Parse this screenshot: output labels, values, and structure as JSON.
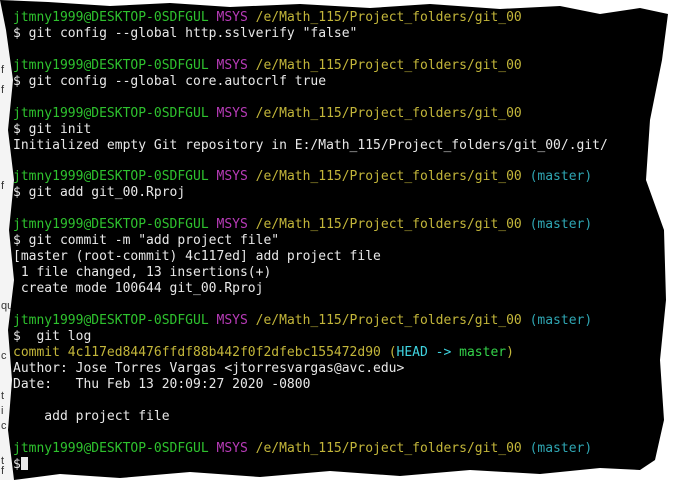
{
  "prompt": {
    "user_host": "jtmny1999@DESKTOP-0SDFGUL",
    "system": "MSYS",
    "path": "/e/Math_115/Project_folders/git_00",
    "branch": "(master)"
  },
  "blocks": [
    {
      "branch": false,
      "lines": [
        "$ git config --global http.sslverify \"false\""
      ]
    },
    {
      "branch": false,
      "lines": [
        "$ git config --global core.autocrlf true"
      ]
    },
    {
      "branch": false,
      "lines": [
        "$ git init",
        "Initialized empty Git repository in E:/Math_115/Project_folders/git_00/.git/"
      ]
    },
    {
      "branch": true,
      "lines": [
        "$ git add git_00.Rproj"
      ]
    },
    {
      "branch": true,
      "lines": [
        "$ git commit -m \"add project file\"",
        "[master (root-commit) 4c117ed] add project file",
        " 1 file changed, 13 insertions(+)",
        " create mode 100644 git_00.Rproj"
      ]
    }
  ],
  "log": {
    "command": "$  git log",
    "commit_label": "commit",
    "commit_hash": "4c117ed84476ffdf88b442f0f2dfebc155472d90",
    "head_ref": "HEAD -> master",
    "author": "Author: Jose Torres Vargas <jtorresvargas@avc.edu>",
    "date": "Date:   Thu Feb 13 20:09:27 2020 -0800",
    "message": "    add project file"
  },
  "final_prompt": "$",
  "background_window_fragments": [
    "f",
    "f",
    "f",
    "qu",
    "c",
    "t",
    "i",
    "c",
    "t",
    "f"
  ]
}
